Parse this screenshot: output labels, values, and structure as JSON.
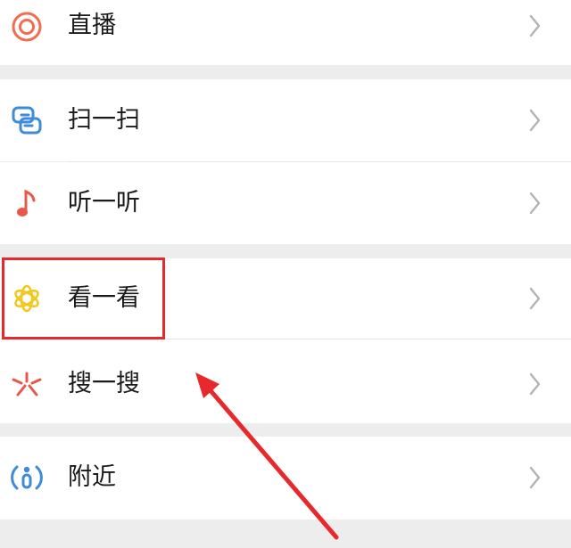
{
  "menu": {
    "items": [
      {
        "label": "直播",
        "icon": "live-icon"
      },
      {
        "label": "扫一扫",
        "icon": "scan-icon"
      },
      {
        "label": "听一听",
        "icon": "music-note-icon"
      },
      {
        "label": "看一看",
        "icon": "flower-icon"
      },
      {
        "label": "搜一搜",
        "icon": "search-star-icon"
      },
      {
        "label": "附近",
        "icon": "nearby-person-icon"
      }
    ]
  },
  "colors": {
    "live": "#f26c4f",
    "scan": "#3d8bd9",
    "music": "#e8574a",
    "flower": "#f2c81f",
    "search": "#e8574a",
    "nearby": "#3d8bd9",
    "annotation": "#e8292b",
    "background": "#ededed"
  }
}
